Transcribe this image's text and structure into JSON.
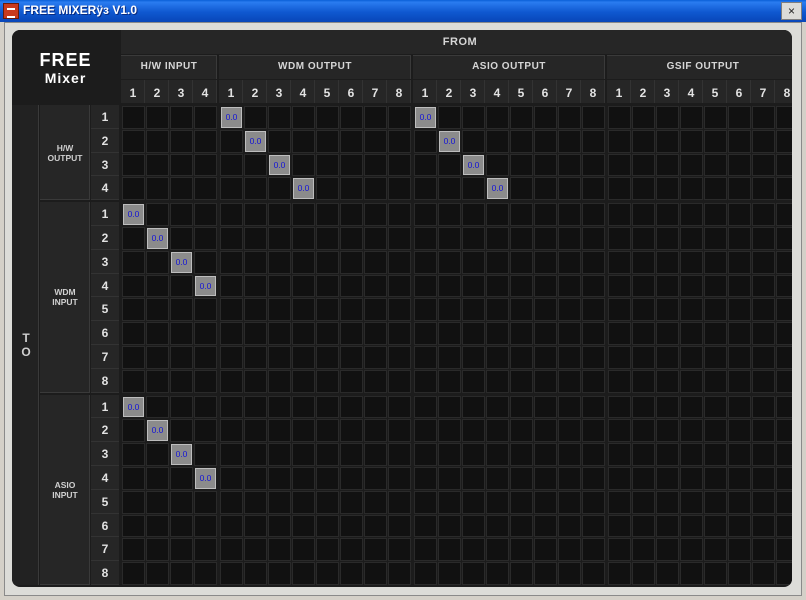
{
  "window": {
    "title": "FREE MIXERÿз V1.0",
    "close_glyph": "×"
  },
  "logo": {
    "line1": "FREE",
    "line2": "Mixer"
  },
  "from_label": "FROM",
  "to_label": "TO",
  "columns": {
    "groups": [
      {
        "label": "H/W INPUT",
        "channels": [
          "1",
          "2",
          "3",
          "4"
        ]
      },
      {
        "label": "WDM OUTPUT",
        "channels": [
          "1",
          "2",
          "3",
          "4",
          "5",
          "6",
          "7",
          "8"
        ]
      },
      {
        "label": "ASIO OUTPUT",
        "channels": [
          "1",
          "2",
          "3",
          "4",
          "5",
          "6",
          "7",
          "8"
        ]
      },
      {
        "label": "GSIF OUTPUT",
        "channels": [
          "1",
          "2",
          "3",
          "4",
          "5",
          "6",
          "7",
          "8"
        ]
      }
    ]
  },
  "rows": {
    "groups": [
      {
        "label": "H/W OUTPUT",
        "channels": [
          "1",
          "2",
          "3",
          "4"
        ]
      },
      {
        "label": "WDM INPUT",
        "channels": [
          "1",
          "2",
          "3",
          "4",
          "5",
          "6",
          "7",
          "8"
        ]
      },
      {
        "label": "ASIO INPUT",
        "channels": [
          "1",
          "2",
          "3",
          "4",
          "5",
          "6",
          "7",
          "8"
        ]
      }
    ]
  },
  "active_cells": [
    {
      "row_group": "H/W OUTPUT",
      "row": "1",
      "col_group": "WDM OUTPUT",
      "col": "1",
      "value": "0.0"
    },
    {
      "row_group": "H/W OUTPUT",
      "row": "2",
      "col_group": "WDM OUTPUT",
      "col": "2",
      "value": "0.0"
    },
    {
      "row_group": "H/W OUTPUT",
      "row": "3",
      "col_group": "WDM OUTPUT",
      "col": "3",
      "value": "0.0"
    },
    {
      "row_group": "H/W OUTPUT",
      "row": "4",
      "col_group": "WDM OUTPUT",
      "col": "4",
      "value": "0.0"
    },
    {
      "row_group": "H/W OUTPUT",
      "row": "1",
      "col_group": "ASIO OUTPUT",
      "col": "1",
      "value": "0.0"
    },
    {
      "row_group": "H/W OUTPUT",
      "row": "2",
      "col_group": "ASIO OUTPUT",
      "col": "2",
      "value": "0.0"
    },
    {
      "row_group": "H/W OUTPUT",
      "row": "3",
      "col_group": "ASIO OUTPUT",
      "col": "3",
      "value": "0.0"
    },
    {
      "row_group": "H/W OUTPUT",
      "row": "4",
      "col_group": "ASIO OUTPUT",
      "col": "4",
      "value": "0.0"
    },
    {
      "row_group": "WDM INPUT",
      "row": "1",
      "col_group": "H/W INPUT",
      "col": "1",
      "value": "0.0"
    },
    {
      "row_group": "WDM INPUT",
      "row": "2",
      "col_group": "H/W INPUT",
      "col": "2",
      "value": "0.0"
    },
    {
      "row_group": "WDM INPUT",
      "row": "3",
      "col_group": "H/W INPUT",
      "col": "3",
      "value": "0.0"
    },
    {
      "row_group": "WDM INPUT",
      "row": "4",
      "col_group": "H/W INPUT",
      "col": "4",
      "value": "0.0"
    },
    {
      "row_group": "ASIO INPUT",
      "row": "1",
      "col_group": "H/W INPUT",
      "col": "1",
      "value": "0.0"
    },
    {
      "row_group": "ASIO INPUT",
      "row": "2",
      "col_group": "H/W INPUT",
      "col": "2",
      "value": "0.0"
    },
    {
      "row_group": "ASIO INPUT",
      "row": "3",
      "col_group": "H/W INPUT",
      "col": "3",
      "value": "0.0"
    },
    {
      "row_group": "ASIO INPUT",
      "row": "4",
      "col_group": "H/W INPUT",
      "col": "4",
      "value": "0.0"
    }
  ]
}
